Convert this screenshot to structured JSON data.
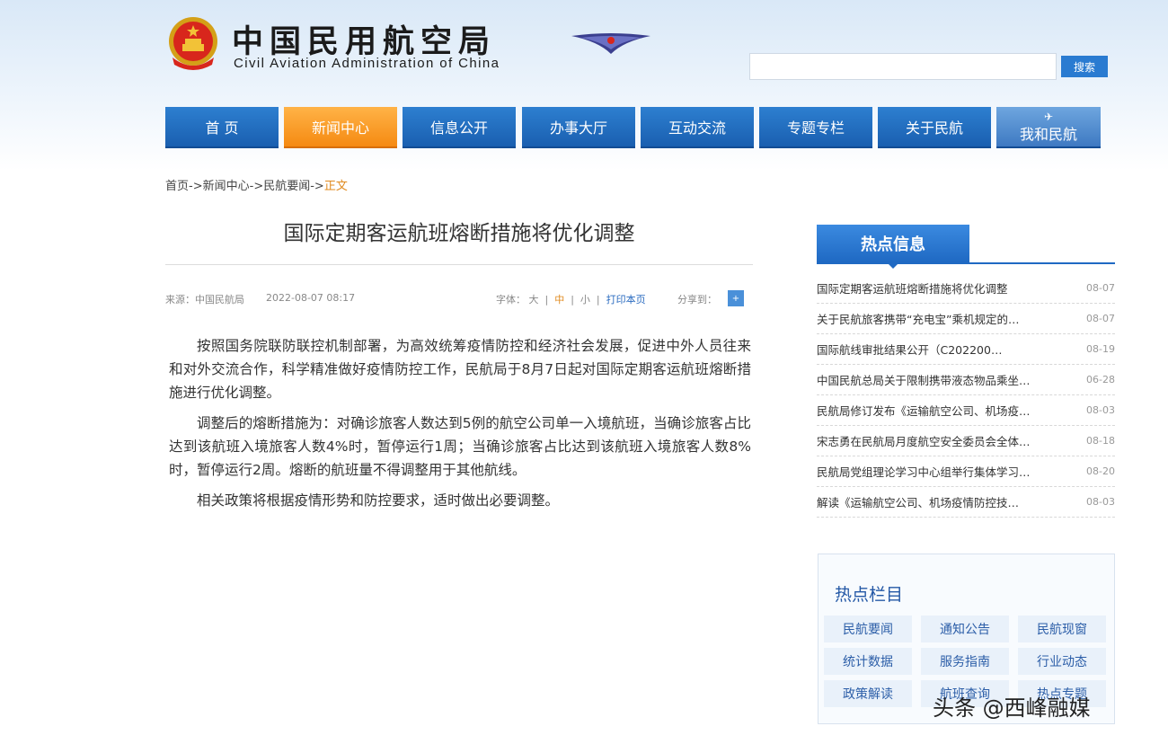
{
  "header": {
    "title_cn": "中国民用航空局",
    "title_en": "Civil Aviation Administration of China",
    "search_placeholder": "",
    "search_button": "搜索"
  },
  "nav": {
    "items": [
      {
        "label": "首 页"
      },
      {
        "label": "新闻中心"
      },
      {
        "label": "信息公开"
      },
      {
        "label": "办事大厅"
      },
      {
        "label": "互动交流"
      },
      {
        "label": "专题专栏"
      },
      {
        "label": "关于民航"
      },
      {
        "label": "我和民航"
      }
    ],
    "active_index": 1
  },
  "breadcrumb": {
    "home": "首页",
    "news": "新闻中心",
    "section": "民航要闻",
    "current": "正文",
    "sep": "->"
  },
  "article": {
    "title": "国际定期客运航班熔断措施将优化调整",
    "source": "来源：中国民航局",
    "date": "2022-08-07 08:17",
    "font_label": "字体：",
    "font_large": "大",
    "font_medium": "中",
    "font_small": "小",
    "print": "打印本页",
    "share": "分享到：",
    "paragraphs": [
      "按照国务院联防联控机制部署，为高效统筹疫情防控和经济社会发展，促进中外人员往来和对外交流合作，科学精准做好疫情防控工作，民航局于8月7日起对国际定期客运航班熔断措施进行优化调整。",
      "调整后的熔断措施为：对确诊旅客人数达到5例的航空公司单一入境航班，当确诊旅客占比达到该航班入境旅客人数4%时，暂停运行1周；当确诊旅客占比达到该航班入境旅客人数8%时，暂停运行2周。熔断的航班量不得调整用于其他航线。",
      "相关政策将根据疫情形势和防控要求，适时做出必要调整。"
    ]
  },
  "hot_info": {
    "title": "热点信息",
    "items": [
      {
        "title": "国际定期客运航班熔断措施将优化调整",
        "date": "08-07"
      },
      {
        "title": "关于民航旅客携带“充电宝”乘机规定的…",
        "date": "08-07"
      },
      {
        "title": "国际航线审批结果公开（C202200…",
        "date": "08-19"
      },
      {
        "title": "中国民航总局关于限制携带液态物品乘坐…",
        "date": "06-28"
      },
      {
        "title": "民航局修订发布《运输航空公司、机场疫…",
        "date": "08-03"
      },
      {
        "title": "宋志勇在民航局月度航空安全委员会全体…",
        "date": "08-18"
      },
      {
        "title": "民航局党组理论学习中心组举行集体学习…",
        "date": "08-20"
      },
      {
        "title": "解读《运输航空公司、机场疫情防控技…",
        "date": "08-03"
      }
    ]
  },
  "hot_columns": {
    "title": "热点栏目",
    "items": [
      "民航要闻",
      "通知公告",
      "民航现窗",
      "统计数据",
      "服务指南",
      "行业动态",
      "政策解读",
      "航班查询",
      "热点专题"
    ]
  },
  "watermark": "头条 @西峰融媒"
}
